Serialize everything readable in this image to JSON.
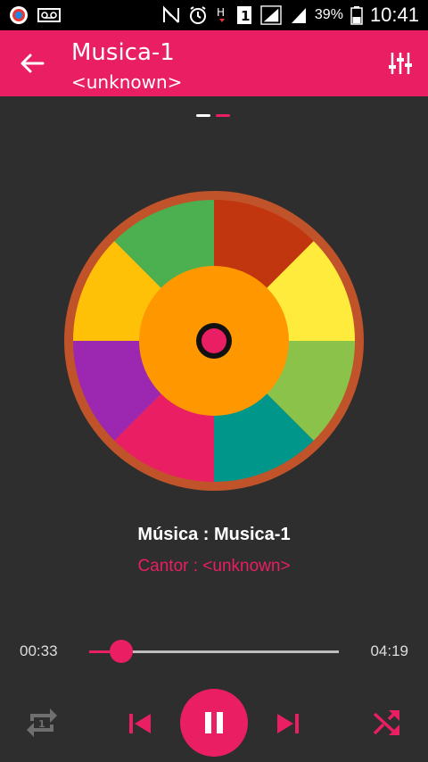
{
  "status_bar": {
    "battery": "39%",
    "time": "10:41"
  },
  "header": {
    "title": "Musica-1",
    "subtitle": "<unknown>"
  },
  "now_playing": {
    "song_line": "Música : Musica-1",
    "artist_line": "Cantor : <unknown>"
  },
  "player": {
    "current_time": "00:33",
    "total_time": "04:19",
    "progress_fraction": 0.127
  },
  "colors": {
    "accent": "#e91e63",
    "appbar": "#e91e63",
    "background": "#2e2e2e",
    "disc_rim": "#c1532a",
    "disc_center": "#ff9800",
    "disc_segments": [
      "#c1360f",
      "#ffeb3b",
      "#8bc34a",
      "#00968a",
      "#e91e63",
      "#9c27b0",
      "#ffc107",
      "#4caf50"
    ]
  },
  "pager": {
    "pages": 2,
    "active_index": 1
  }
}
